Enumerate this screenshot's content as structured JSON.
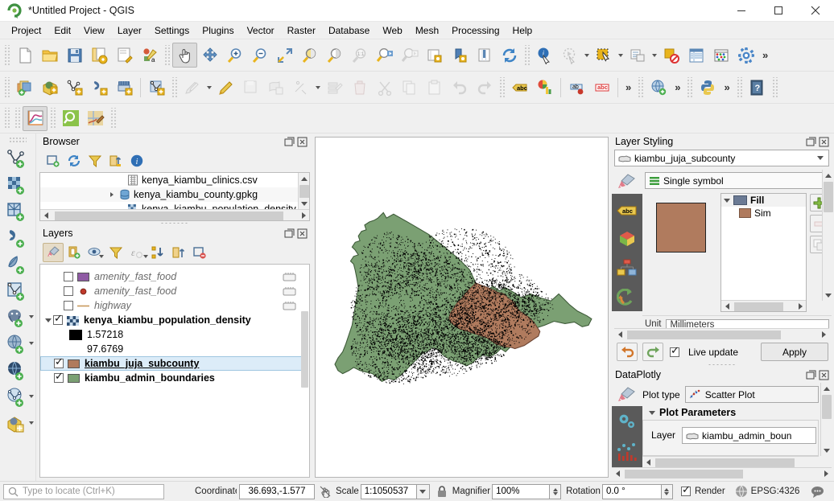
{
  "window": {
    "title": "*Untitled Project - QGIS",
    "app_icon": "qgis-logo-icon",
    "minimize_label": "—",
    "maximize_label": "▢",
    "close_label": "✕"
  },
  "menubar": {
    "items": [
      {
        "label": "Project",
        "mnemonic": "P"
      },
      {
        "label": "Edit",
        "mnemonic": "E"
      },
      {
        "label": "View",
        "mnemonic": "V"
      },
      {
        "label": "Layer",
        "mnemonic": "L"
      },
      {
        "label": "Settings",
        "mnemonic": "S"
      },
      {
        "label": "Plugins",
        "mnemonic": "P"
      },
      {
        "label": "Vector",
        "mnemonic": "o"
      },
      {
        "label": "Raster",
        "mnemonic": "R"
      },
      {
        "label": "Database",
        "mnemonic": "D"
      },
      {
        "label": "Web",
        "mnemonic": "W"
      },
      {
        "label": "Mesh",
        "mnemonic": "M"
      },
      {
        "label": "Processing",
        "mnemonic": "c"
      },
      {
        "label": "Help",
        "mnemonic": "H"
      }
    ],
    "overflow_label": "»"
  },
  "toolbars": {
    "row1": [
      "new-project-icon",
      "open-project-icon",
      "save-project-icon",
      "save-project-as-icon",
      "new-print-layout-icon",
      "style-manager-icon",
      "pan-map-icon",
      "pan-to-selection-icon",
      "zoom-in-icon",
      "zoom-out-icon",
      "zoom-full-icon",
      "zoom-to-selection-icon",
      "zoom-to-layer-icon",
      "zoom-native-icon",
      "zoom-last-icon",
      "zoom-next-icon",
      "refresh-layer-icon",
      "new-map-view-icon",
      "new-3d-map-view-icon",
      "refresh-icon",
      "identify-features-icon",
      "run-feature-action-icon",
      "select-features-icon",
      "deselect-features-icon",
      "clear-selection-icon",
      "open-attribute-table-icon",
      "field-calculator-icon",
      "options-icon"
    ],
    "row2": [
      "add-vector-layer-icon",
      "add-raster-layer-icon",
      "add-mesh-layer-icon",
      "add-delimited-text-icon",
      "add-wms-layer-icon",
      "current-edits-icon",
      "toggle-editing-icon",
      "save-layer-edits-icon",
      "add-polygon-icon",
      "add-feature-icon",
      "vertex-tool-icon",
      "modify-attributes-icon",
      "delete-selected-icon",
      "cut-features-icon",
      "copy-features-icon",
      "paste-features-icon",
      "undo-icon",
      "redo-icon",
      "label-icon",
      "diagram-icon",
      "move-label-icon",
      "rotate-label-icon",
      "metasearch-icon",
      "python-console-icon",
      "help-icon"
    ],
    "row3": [
      "dataplotly-icon",
      "search-qgis-icon",
      "qgis-map-icon"
    ],
    "overflow_label": "»"
  },
  "left_rail": {
    "items": [
      {
        "name": "add-vector-layer-icon",
        "has_menu": false
      },
      {
        "name": "add-raster-layer-icon",
        "has_menu": false
      },
      {
        "name": "add-mesh-layer-icon",
        "has_menu": false
      },
      {
        "name": "add-delimited-text-layer-icon",
        "has_menu": false
      },
      {
        "name": "add-spatialite-layer-icon",
        "has_menu": false
      },
      {
        "name": "add-vector-tile-layer-icon",
        "has_menu": false
      },
      {
        "name": "add-postgis-layer-icon",
        "has_menu": true
      },
      {
        "name": "add-wms-layer-icon",
        "has_menu": true
      },
      {
        "name": "add-wfs-layer-icon",
        "has_menu": false
      },
      {
        "name": "add-web-mesh-layer-icon",
        "has_menu": true
      },
      {
        "name": "new-virtual-layer-icon",
        "has_menu": true
      }
    ]
  },
  "browser_panel": {
    "title": "Browser",
    "float_icon": "float-panel-icon",
    "close_icon": "close-panel-icon",
    "toolbar": [
      "add-selected-layers-icon",
      "refresh-icon",
      "filter-browser-icon",
      "collapse-all-icon",
      "enable-properties-icon"
    ],
    "items": [
      {
        "label": "kenya_kiambu_clinics.csv",
        "icon": "csv-file-icon",
        "expandable": false
      },
      {
        "label": "kenya_kiambu_county.gpkg",
        "icon": "geopackage-icon",
        "expandable": true
      },
      {
        "label": "kenya_kiambu_population_density.tif",
        "icon": "raster-file-icon",
        "expandable": false
      }
    ]
  },
  "layers_panel": {
    "title": "Layers",
    "float_icon": "float-panel-icon",
    "close_icon": "close-panel-icon",
    "toolbar": [
      "open-layer-styling-icon",
      "add-group-icon",
      "manage-visibility-icon",
      "filter-legend-icon",
      "filter-legend-expression-icon",
      "expand-all-icon",
      "collapse-all-icon",
      "remove-layer-icon"
    ],
    "layers": [
      {
        "label": "amenity_fast_food",
        "checked": false,
        "style": "italic",
        "symbol": "polygon-swatch",
        "color": "#8f5ba4",
        "has_edit_icon": true,
        "expandable": false
      },
      {
        "label": "amenity_fast_food",
        "checked": false,
        "style": "italic",
        "symbol": "point-swatch",
        "color": "#c0392b",
        "has_edit_icon": true,
        "expandable": false
      },
      {
        "label": "highway",
        "checked": false,
        "style": "italic",
        "symbol": "line-swatch",
        "color": "#c89a5c",
        "has_edit_icon": true,
        "expandable": false
      },
      {
        "label": "kenya_kiambu_population_density",
        "checked": true,
        "style": "bold",
        "symbol": "raster-swatch",
        "color": "#3a5f8a",
        "has_edit_icon": false,
        "expandable": true
      },
      {
        "label": "kiambu_juja_subcounty",
        "checked": true,
        "style": "selected",
        "symbol": "polygon-swatch",
        "color": "#b07b5e",
        "has_edit_icon": false,
        "expandable": false
      },
      {
        "label": "kiambu_admin_boundaries",
        "checked": true,
        "style": "bold",
        "symbol": "polygon-swatch",
        "color": "#7ba073",
        "has_edit_icon": false,
        "expandable": false
      }
    ],
    "raster_legend": [
      {
        "label": "1.57218",
        "color": "#000000",
        "show_swatch": true
      },
      {
        "label": "97.6769",
        "color": "#ffffff",
        "show_swatch": false
      }
    ]
  },
  "layer_styling_panel": {
    "title": "Layer Styling",
    "float_icon": "float-panel-icon",
    "close_icon": "close-panel-icon",
    "layer_combo": {
      "value": "kiambu_juja_subcounty",
      "icon": "polygon-layer-icon"
    },
    "renderer_combo": {
      "value": "Single symbol",
      "icon": "single-symbol-icon"
    },
    "rail_items": [
      "symbology-icon",
      "labels-icon",
      "3d-view-icon",
      "diagrams-icon",
      "history-icon"
    ],
    "symbol_tree": [
      {
        "label": "Fill",
        "color": "#6b7a94",
        "level": 0,
        "bold": true,
        "expandable": true
      },
      {
        "label": "Sim",
        "color": "#b07b5e",
        "level": 1,
        "bold": false,
        "expandable": false
      }
    ],
    "preview_color": "#b07b5e",
    "unit_label": "Unit",
    "unit_value": "Millimeters",
    "undo_icon": "undo-icon",
    "redo_icon": "redo-icon",
    "live_update_label": "Live update",
    "live_update_checked": true,
    "apply_label": "Apply",
    "side_buttons": [
      "add-symbol-layer-icon",
      "remove-symbol-layer-icon",
      "duplicate-symbol-layer-icon"
    ]
  },
  "dataplotly_panel": {
    "title": "DataPlotly",
    "float_icon": "float-panel-icon",
    "close_icon": "close-panel-icon",
    "plot_type_label": "Plot type",
    "plot_type_value": "Scatter Plot",
    "plot_type_icon": "scatter-plot-icon",
    "section_label": "Plot Parameters",
    "layer_label": "Layer",
    "layer_value": "kiambu_admin_boun",
    "layer_icon": "polygon-layer-icon",
    "rail_items": [
      "plot-settings-icon",
      "plot-chart-icon"
    ]
  },
  "statusbar": {
    "locate_placeholder": "Type to locate (Ctrl+K)",
    "locate_icon": "search-icon",
    "coordinate_label": "Coordinate",
    "coordinate_value": "36.693,-1.577",
    "coordinate_toggle_icon": "toggle-extents-icon",
    "scale_label": "Scale",
    "scale_value": "1:1050537",
    "lock_icon": "lock-scale-icon",
    "magnifier_label": "Magnifier",
    "magnifier_value": "100%",
    "rotation_label": "Rotation",
    "rotation_value": "0.0 °",
    "render_label": "Render",
    "render_checked": true,
    "crs_value": "EPSG:4326",
    "crs_icon": "globe-icon",
    "messages_icon": "messages-icon"
  },
  "map": {
    "background": "#ffffff",
    "admin_fill": "#7ba073",
    "admin_stroke": "#3d5a38",
    "subcounty_fill": "#b07b5e",
    "subcounty_stroke": "#6b4332",
    "density_dot_color": "#000000"
  }
}
